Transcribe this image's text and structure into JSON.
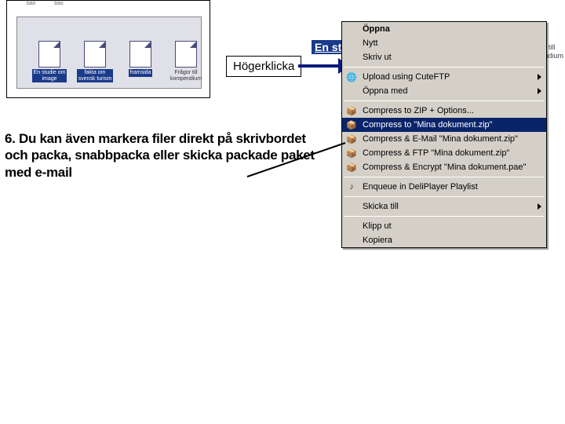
{
  "folder": {
    "top_labels": [
      "bas",
      "bas"
    ],
    "files": [
      {
        "label": "En studie om\nimage",
        "selected": true
      },
      {
        "label": "fakta om\nsvensk turism",
        "selected": true
      },
      {
        "label": "framsida",
        "selected": true
      },
      {
        "label": "Frågor till\nkompendium",
        "selected": false
      }
    ]
  },
  "callout_label": "Högerklicka",
  "peek_left": "En st",
  "peek_right_line1": "or till",
  "peek_right_line2": "endium",
  "instruction": "6. Du kan även markera filer direkt på skrivbordet och packa, snabbpacka eller skicka packade paket med e-mail",
  "menu": [
    {
      "type": "item",
      "label": "Öppna",
      "bold": true
    },
    {
      "type": "item",
      "label": "Nytt"
    },
    {
      "type": "item",
      "label": "Skriv ut"
    },
    {
      "type": "sep"
    },
    {
      "type": "item",
      "label": "Upload using CuteFTP",
      "icon": "globe",
      "iconcls": "ic-g",
      "submenu": true
    },
    {
      "type": "item",
      "label": "Öppna med",
      "submenu": true
    },
    {
      "type": "sep"
    },
    {
      "type": "item",
      "label": "Compress to ZIP + Options...",
      "icon": "zip",
      "iconcls": "ic-y"
    },
    {
      "type": "item",
      "label": "Compress to \"Mina dokument.zip\"",
      "icon": "zip",
      "iconcls": "ic-y",
      "hi": true
    },
    {
      "type": "item",
      "label": "Compress & E-Mail \"Mina dokument.zip\"",
      "icon": "zip",
      "iconcls": "ic-y"
    },
    {
      "type": "item",
      "label": "Compress & FTP \"Mina dokument.zip\"",
      "icon": "zip",
      "iconcls": "ic-y"
    },
    {
      "type": "item",
      "label": "Compress & Encrypt \"Mina dokument.pae\"",
      "icon": "zip",
      "iconcls": "ic-y"
    },
    {
      "type": "sep"
    },
    {
      "type": "item",
      "label": "Enqueue in DeliPlayer Playlist",
      "icon": "note",
      "iconcls": "ic-k"
    },
    {
      "type": "sep"
    },
    {
      "type": "item",
      "label": "Skicka till",
      "submenu": true
    },
    {
      "type": "sep"
    },
    {
      "type": "item",
      "label": "Klipp ut"
    },
    {
      "type": "item",
      "label": "Kopiera"
    }
  ]
}
